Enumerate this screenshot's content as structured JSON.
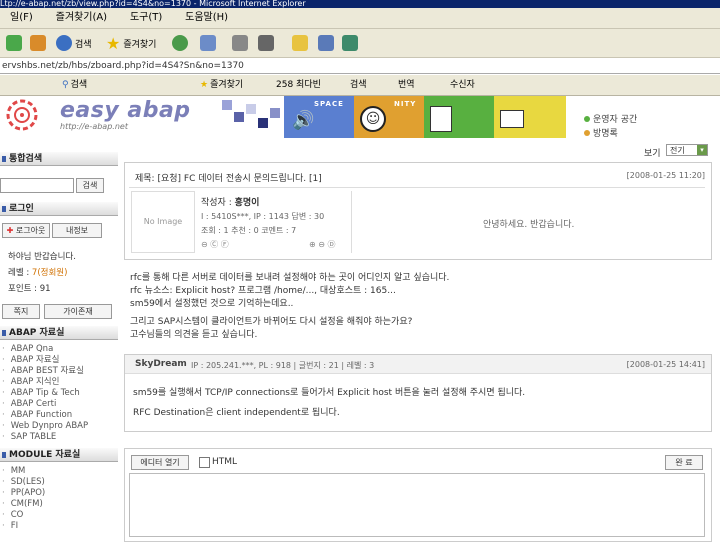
{
  "window": {
    "title": "Ltp://e-abap.net/zb/view.php?id=4S4&no=1370 - Microsoft Internet Explorer"
  },
  "menu": {
    "items": [
      "일(F)",
      "즐겨찾기(A)",
      "도구(T)",
      "도움말(H)"
    ]
  },
  "toolbar": {
    "search_label": "검색",
    "favorites_label": "즐겨찾기"
  },
  "address": {
    "value": "ervshbs.net/zb/hbs/zboard.php?id=4S4?Sn&no=1370"
  },
  "links_bar": {
    "items": [
      "검색",
      "즐겨찾기",
      "258 최다빈",
      "검색",
      "번역",
      "수신자"
    ]
  },
  "site": {
    "logo": "easy abap",
    "logo_url": "http://e-abap.net",
    "nav_labels": [
      "SPACE",
      "NITY"
    ],
    "side_links": [
      "운영자 공간",
      "방명록"
    ]
  },
  "sidebar": {
    "search_title": "통합검색",
    "search_button": "검색",
    "login_title": "로그인",
    "logout_button": "로그아웃",
    "info_button": "내정보",
    "greeting": "하야님 반갑습니다.",
    "level_label": "레벨 : ",
    "level_value": "7(정회원)",
    "point_label": "포인트 : ",
    "point_value": "91",
    "memo_button": "쪽지",
    "mypost_button": "가이존재",
    "abap_title": "ABAP 자료실",
    "abap_items": [
      "ABAP Qna",
      "ABAP 자료실",
      "ABAP BEST 자료실",
      "ABAP 지식인",
      "ABAP Tip & Tech",
      "ABAP Certi",
      "ABAP Function",
      "Web Dynpro ABAP",
      "SAP TABLE"
    ],
    "module_title": "MODULE 자료실",
    "module_items": [
      "MM",
      "SD(LES)",
      "PP(APO)",
      "CM(FM)",
      "CO",
      "FI"
    ]
  },
  "post": {
    "view_label": "보기",
    "view_value": "전기",
    "title": "제목: [요청] FC 데이터 전송시 문의드립니다. [1]",
    "date": "[2008-01-25 11:20]",
    "no_image": "No Image",
    "author_label": "작성자 :",
    "author": "홍명이",
    "meta_line1": "I : 5410S***, IP : 1143 답변 : 30",
    "meta_line2": "조회 : 1  추천 : 0  코멘트 : 7",
    "greeting_text": "안녕하세요. 반갑습니다.",
    "body_lines": [
      "rfc를 통해 다른 서버로 데이터를 보내려 설정해야 하는 곳이 어디인지 알고 싶습니다.",
      "rfc 뉴소스: Explicit host? 프로그램 /home/..., 대상호스트 : 165...",
      "sm59에서 설정했던 것으로 기억하는데요..",
      "",
      "그리고 SAP시스템이 클라이언트가 바뀌어도 다시 설정을 해줘야 하는가요?",
      "고수님들의 의견을 듣고 싶습니다."
    ]
  },
  "comment": {
    "author": "SkyDream",
    "meta": "IP : 205.241.***,  PL : 918  |  글번지 : 21  |  레벨 : 3",
    "date": "[2008-01-25 14:41]",
    "lines": [
      "sm59를 실행해서 TCP/IP connections로 들어가서 Explicit host 버튼을 눌러 설정해 주시면 됩니다.",
      "RFC Destination은 client independent로 됩니다."
    ]
  },
  "reply": {
    "editor_button": "에디터 열기",
    "html_label": "HTML",
    "submit_button": "완 료"
  }
}
